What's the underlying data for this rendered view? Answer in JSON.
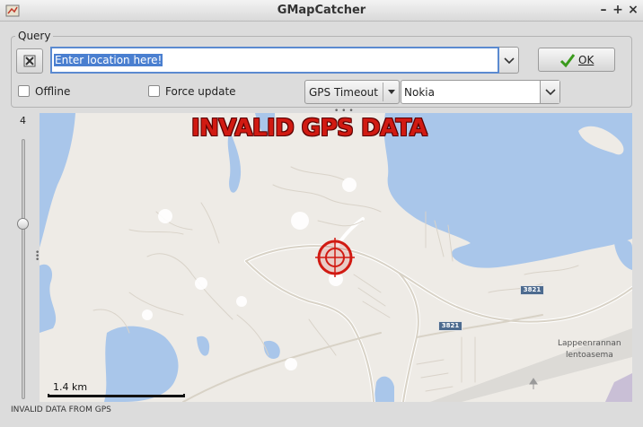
{
  "window": {
    "title": "GMapCatcher"
  },
  "query": {
    "frame_label": "Query",
    "location_placeholder_selected": "Enter location here!",
    "ok_label": "OK"
  },
  "options": {
    "offline_label": "Offline",
    "offline_checked": false,
    "force_update_label": "Force update",
    "force_update_checked": false,
    "gps_timeout_label": "GPS Timeout",
    "map_source": "Nokia"
  },
  "zoom": {
    "level": "4"
  },
  "map": {
    "overlay_title": "INVALID GPS DATA",
    "scale_label": "1.4 km",
    "place_label_1": "Lappeenrannan",
    "place_label_2": "lentoasema",
    "road_1": "3821",
    "road_2": "3821"
  },
  "status": {
    "text": "INVALID DATA FROM GPS"
  },
  "colors": {
    "water": "#a9c6ea",
    "land": "#eeebe6",
    "target": "#d11a12",
    "selection": "#4a7fd0"
  }
}
